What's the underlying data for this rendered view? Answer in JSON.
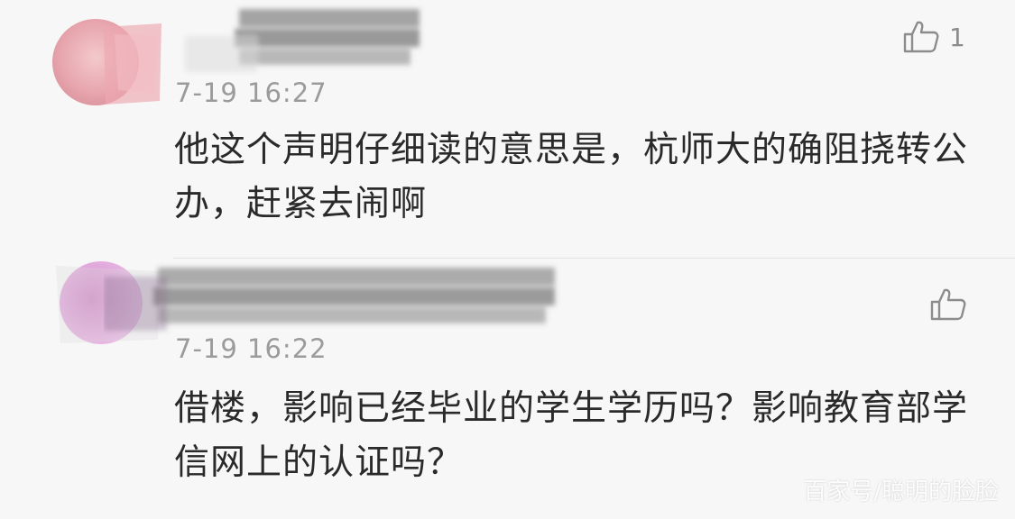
{
  "comments": [
    {
      "timestamp": "7-19 16:27",
      "text": "他这个声明仔细读的意思是，杭师大的确阻挠转公办，赶紧去闹啊",
      "likes": "1",
      "like_icon": "thumb-up-icon"
    },
    {
      "timestamp": "7-19 16:22",
      "text": "借楼，影响已经毕业的学生学历吗？影响教育部学信网上的认证吗？",
      "likes": "",
      "like_icon": "thumb-up-icon"
    }
  ],
  "watermark": "百家号/聪明的脸脸",
  "colors": {
    "background": "#f7f7f7",
    "text": "#2a2a2a",
    "meta": "#9b9b9b",
    "divider": "#e3e3e3"
  }
}
